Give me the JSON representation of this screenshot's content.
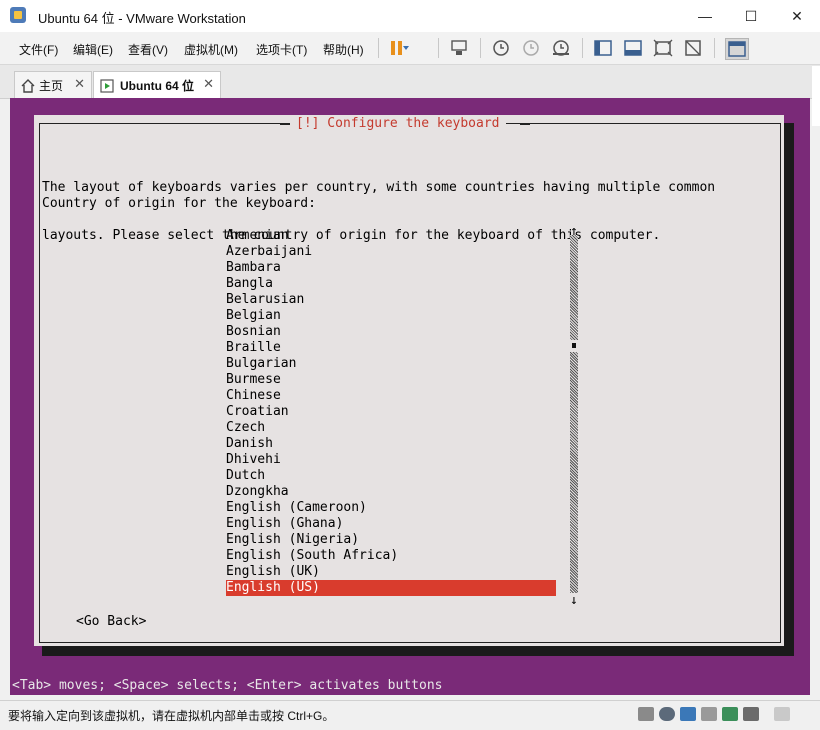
{
  "window": {
    "title": "Ubuntu 64 位 - VMware Workstation",
    "minimize": "—",
    "maximize": "☐",
    "close": "✕"
  },
  "menu": {
    "items": [
      "文件(F)",
      "编辑(E)",
      "查看(V)",
      "虚拟机(M)",
      "选项卡(T)",
      "帮助(H)"
    ]
  },
  "tabs": [
    {
      "label": "主页",
      "icon": "home-icon",
      "close": "✕"
    },
    {
      "label": "Ubuntu 64 位",
      "icon": "vm-play-icon",
      "close": "✕"
    }
  ],
  "installer": {
    "title": "[!] Configure the keyboard",
    "intro_line1": "The layout of keyboards varies per country, with some countries having multiple common",
    "intro_line2": "layouts. Please select the country of origin for the keyboard of this computer.",
    "prompt": "Country of origin for the keyboard:",
    "items": [
      "Armenian",
      "Azerbaijani",
      "Bambara",
      "Bangla",
      "Belarusian",
      "Belgian",
      "Bosnian",
      "Braille",
      "Bulgarian",
      "Burmese",
      "Chinese",
      "Croatian",
      "Czech",
      "Danish",
      "Dhivehi",
      "Dutch",
      "Dzongkha",
      "English (Cameroon)",
      "English (Ghana)",
      "English (Nigeria)",
      "English (South Africa)",
      "English (UK)",
      "English (US)"
    ],
    "selected": "English (US)",
    "scroll_up": "↑",
    "scroll_down": "↓",
    "go_back": "<Go Back>",
    "hint": "<Tab> moves; <Space> selects; <Enter> activates buttons"
  },
  "status": {
    "text": "要将输入定向到该虚拟机，请在虚拟机内部单击或按 Ctrl+G。"
  },
  "colors": {
    "vm_background": "#7a2a78",
    "dialog": "#e6e2e2",
    "title_text": "#c43a2e",
    "selection": "#d93c2d"
  }
}
